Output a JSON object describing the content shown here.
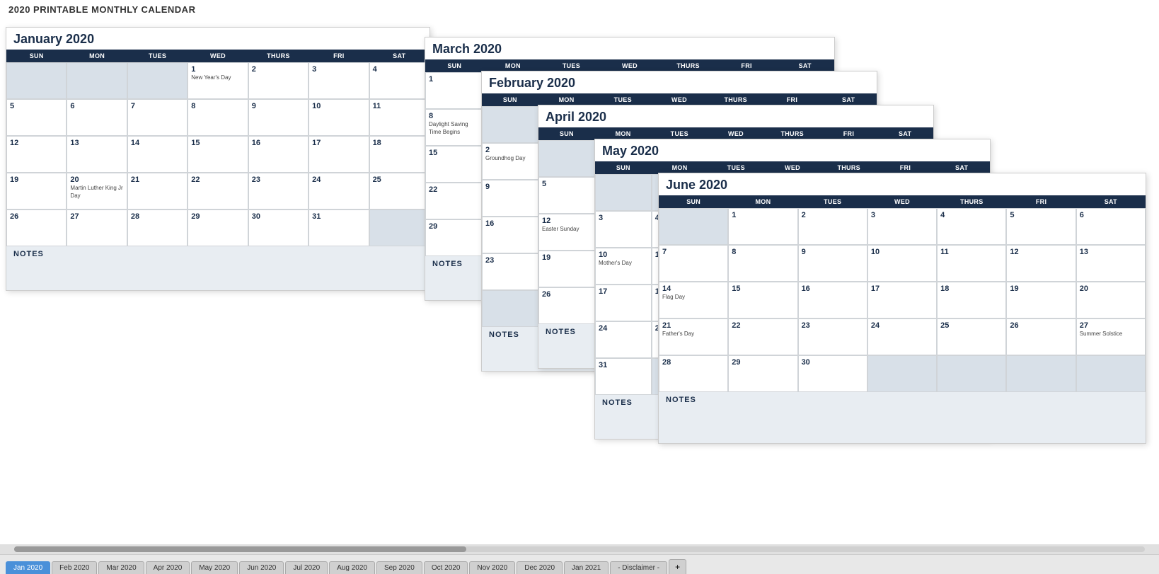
{
  "app": {
    "title": "2020 PRINTABLE MONTHLY CALENDAR"
  },
  "calendars": {
    "january": {
      "title": "January 2020",
      "days": [
        "SUN",
        "MON",
        "TUES",
        "WED",
        "THURS",
        "FRI",
        "SAT"
      ],
      "holidays": {
        "1": "New Year's Day",
        "20": "Martin Luther King Jr Day"
      }
    },
    "march": {
      "title": "March 2020",
      "days": [
        "SUN",
        "MON",
        "TUES",
        "WED",
        "THURS",
        "FRI",
        "SAT"
      ],
      "holidays": {
        "8": "Daylight Saving Time Begins"
      }
    },
    "february": {
      "title": "February 2020",
      "days": [
        "SUN",
        "MON",
        "TUES",
        "WED",
        "THURS",
        "FRI",
        "SAT"
      ],
      "holidays": {
        "2": "Groundhog Day"
      }
    },
    "april": {
      "title": "April 2020",
      "days": [
        "SUN",
        "MON",
        "TUES",
        "WED",
        "THURS",
        "FRI",
        "SAT"
      ],
      "holidays": {
        "12": "Easter Sunday"
      }
    },
    "may": {
      "title": "May 2020",
      "days": [
        "SUN",
        "MON",
        "TUES",
        "WED",
        "THURS",
        "FRI",
        "SAT"
      ],
      "holidays": {
        "10": "Mother's Day"
      }
    },
    "june": {
      "title": "June 2020",
      "days": [
        "SUN",
        "MON",
        "TUES",
        "WED",
        "THURS",
        "FRI",
        "SAT"
      ],
      "holidays": {
        "14": "Flag Day",
        "21": "Father's Day",
        "20": "Summer Solstice"
      }
    }
  },
  "notes": {
    "label": "NOTES"
  },
  "tabs": [
    {
      "label": "Jan 2020",
      "active": true
    },
    {
      "label": "Feb 2020",
      "active": false
    },
    {
      "label": "Mar 2020",
      "active": false
    },
    {
      "label": "Apr 2020",
      "active": false
    },
    {
      "label": "May 2020",
      "active": false
    },
    {
      "label": "Jun 2020",
      "active": false
    },
    {
      "label": "Jul 2020",
      "active": false
    },
    {
      "label": "Aug 2020",
      "active": false
    },
    {
      "label": "Sep 2020",
      "active": false
    },
    {
      "label": "Oct 2020",
      "active": false
    },
    {
      "label": "Nov 2020",
      "active": false
    },
    {
      "label": "Dec 2020",
      "active": false
    },
    {
      "label": "Jan 2021",
      "active": false
    },
    {
      "label": "- Disclaimer -",
      "active": false
    }
  ]
}
